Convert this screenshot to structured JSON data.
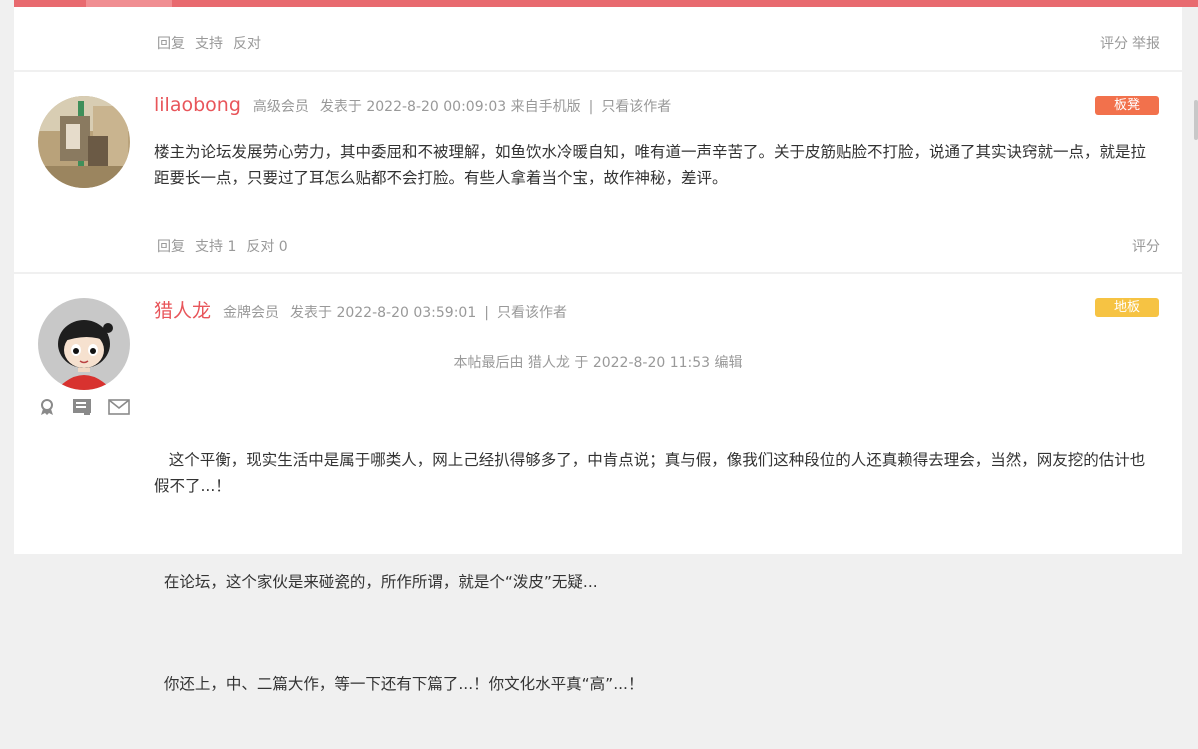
{
  "post0": {
    "actions": [
      "回复",
      "支持",
      "反对"
    ],
    "right_actions": [
      "评分",
      "举报"
    ]
  },
  "post1": {
    "username": "lilaobong",
    "rank": "高级会员",
    "posted": "发表于 2022-8-20 00:09:03 来自手机版",
    "separator": "|",
    "only_author": "只看该作者",
    "floor": "板凳",
    "content": "楼主为论坛发展劳心劳力，其中委屈和不被理解，如鱼饮水冷暖自知，唯有道一声辛苦了。关于皮筋贴脸不打脸，说通了其实诀窍就一点，就是拉距要长一点，只要过了耳怎么贴都不会打脸。有些人拿着当个宝，故作神秘，差评。",
    "actions": [
      "回复",
      "支持 1",
      "反对 0"
    ],
    "right_actions": [
      "评分"
    ]
  },
  "post2": {
    "username": "猎人龙",
    "rank": "金牌会员",
    "posted": "发表于 2022-8-20 03:59:01",
    "separator": "|",
    "only_author": "只看该作者",
    "floor": "地板",
    "edit_note": "本帖最后由 猎人龙 于 2022-8-20 11:53 编辑",
    "paragraphs": [
      "   这个平衡，现实生活中是属于哪类人，网上己经扒得够多了，中肯点说；真与假，像我们这种段位的人还真赖得去理会，当然，网友挖的估计也假不了...！",
      "  在论坛，这个家伙是来碰瓷的，所作所谓，就是个“泼皮”无疑...",
      "  你还上，中、二篇大作，等一下还有下篇了...！你文化水平真“高”...！"
    ]
  },
  "colors": {
    "accent": "#e86a6f",
    "username": "#e8555a",
    "floor_orange": "#f2714c",
    "floor_yellow": "#f6c343"
  }
}
